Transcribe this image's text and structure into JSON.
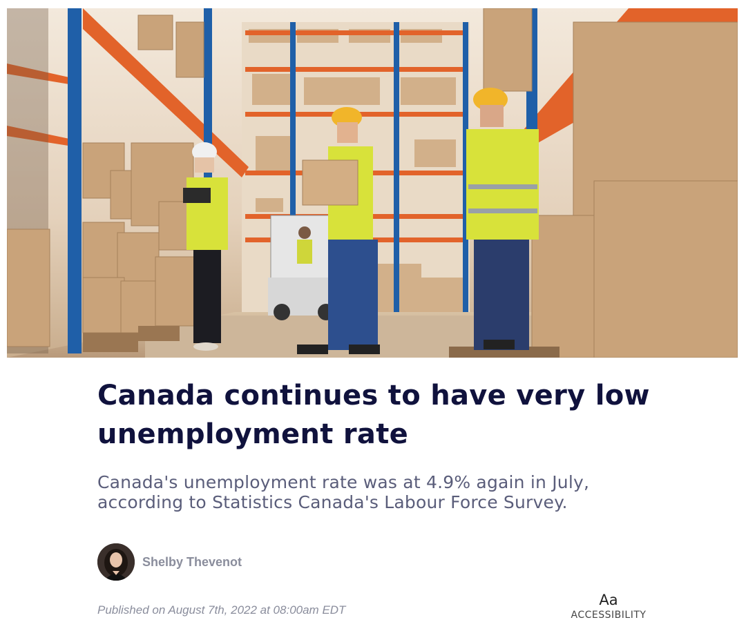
{
  "hero": {
    "image_name": "warehouse-workers-photo",
    "colors": {
      "floor": "#cdb69a",
      "box": "#c9a37a",
      "rack_orange": "#e2632a",
      "rack_blue": "#1f5fa8",
      "vest": "#d8e23a"
    }
  },
  "article": {
    "headline": "Canada continues to have very low unemployment rate",
    "subhead": "Canada's unemployment rate was at 4.9% again in July, according to Statistics Canada's Labour Force Survey."
  },
  "author": {
    "name": "Shelby Thevenot",
    "avatar_icon": "author-avatar"
  },
  "meta": {
    "published": "Published on August 7th, 2022 at 08:00am EDT"
  },
  "accessibility": {
    "icon_text": "Aa",
    "label": "ACCESSIBILITY"
  },
  "colors": {
    "headline": "#10123d",
    "subhead": "#5a5d7a",
    "meta": "#8a8d9c"
  }
}
